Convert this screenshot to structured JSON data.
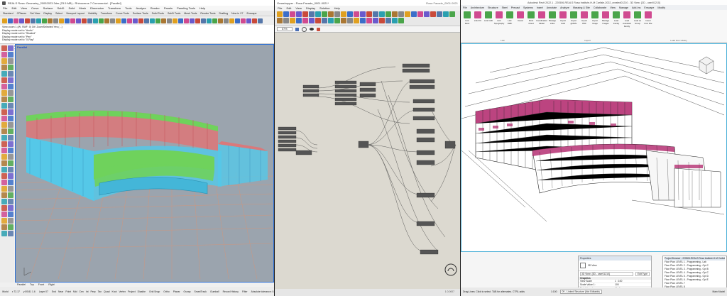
{
  "rhino": {
    "title": "REALS Rosa: Geometry_20052023.3dm (23.5 MB) - Rhinoceros 7 Commercial - [Parallel]",
    "menu": [
      "File",
      "Edit",
      "View",
      "Curve",
      "Surface",
      "SubD",
      "Solid",
      "Mesh",
      "Dimension",
      "Transform",
      "Tools",
      "Analyze",
      "Render",
      "Panels",
      "Paneling Tools",
      "Help"
    ],
    "tabs": [
      "Standard",
      "CPlanes",
      "Set View",
      "Display",
      "Select",
      "Viewport Layout",
      "Visibility",
      "Transform",
      "Curve Tools",
      "Surface Tools",
      "Solid Tools",
      "SubD Tools",
      "Mesh Tools",
      "Render Tools",
      "Drafting",
      "New in V7",
      "Enscape"
    ],
    "history": [
      "View zoom 1 (W, SWF: 0)   Dif: ZoomSelected  Yes  (...)",
      "Display mode set to \"Arctic\"",
      "Display mode set to \"Shaded\"",
      "Display mode set to \"Pen\"",
      "Display mode set to \"X-Ray\""
    ],
    "command_prompt": "Command:",
    "viewport_label": "Parallel",
    "viewport_tabs": [
      "Parallel",
      "Top",
      "Front",
      "Right"
    ],
    "status": [
      "World",
      "x 72.17",
      "y 89.81 1.6",
      "Layer 07",
      "Grid Snap",
      "Ortho",
      "Planar",
      "Osnap",
      "SmartTrack",
      "Gumball",
      "Record History",
      "Filter",
      "Absolute tolerance: 0.01"
    ],
    "osnaps": [
      "End",
      "Near",
      "Point",
      "Mid",
      "Cen",
      "Int",
      "Perp",
      "Tan",
      "Quad",
      "Knot",
      "Vertex",
      "Project",
      "Disable"
    ]
  },
  "grasshopper": {
    "title": "Grasshopper - Rosa Facade_0001.0021*",
    "filename": "Rosa Facade_0001.0021",
    "menu": [
      "File",
      "Edit",
      "View",
      "Display",
      "Solution",
      "Help"
    ],
    "zoom": "57%",
    "version": "1.0.0007"
  },
  "revit": {
    "title": "Autodesk Revit 2022.1 - 220506-REALS Rosa Institute-H-M Carlisle-2022_created01210 - 3D View: {3D - user01210}",
    "tabs": [
      "File",
      "Architecture",
      "Structure",
      "Steel",
      "Precast",
      "Systems",
      "Insert",
      "Annotate",
      "Analyze",
      "Massing & Site",
      "Collaborate",
      "View",
      "Manage",
      "Add-Ins",
      "Enscape",
      "Modify"
    ],
    "ribbon_buttons": [
      "Link Revit",
      "Link IFC",
      "Link CAD",
      "Link Topography",
      "Link DWF",
      "Decal",
      "Point Cloud",
      "Coordination Model",
      "Manage Links",
      "Import CAD",
      "Import gbXML",
      "Import PDF",
      "Import Image",
      "Manage Images",
      "Load Family",
      "Load Autodesk Family",
      "Load as Group",
      "Insert from File"
    ],
    "panel_labels": [
      "Link",
      "Import",
      "Load from Library"
    ],
    "properties": {
      "title": "Properties",
      "type": "3D View",
      "selector": "3D View: {3D - user01210}",
      "edit_type": "Edit Type",
      "group": "Graphics",
      "rows": [
        [
          "View Scale",
          "1 : 100"
        ],
        [
          "Scale Value 1:",
          "100"
        ],
        [
          "Detail Level",
          "Medium"
        ]
      ]
    },
    "browser": {
      "title": "Project Browser - 220506-REALS Rosa Institute-H-M Carlisle",
      "items": [
        "Floor Plan: LEVEL 1 - Programming - Lab",
        "Floor Plan: LEVEL 2 - Programming - Opt C",
        "Floor Plan: LEVEL 3 - Programming - Opt B",
        "Floor Plan: LEVEL 4 - Programming - Opt C",
        "Floor Plan: LEVEL 5 - Programming - Opt D",
        "Floor Plan: LEVEL 6 - Programming - Opt E",
        "Floor Plan: LEVEL 7",
        "Floor Plan: LEVEL 8",
        "Floor Plan: LEVEL 9"
      ]
    },
    "status": "Drag Lines: Click to select. TAB for alternates. CTRL adds",
    "workset": "09 - Linked Structure (Not Editable)",
    "scale": "1:100",
    "model": "Main Model"
  },
  "colors": {
    "rhino_viewport": "#9ba4ae",
    "facade_cyan": "#55c8e8",
    "facade_green": "#6fd25c",
    "facade_red": "#d9797b",
    "revit_magenta": "#b0236a",
    "gh_canvas": "#dcd9d0"
  }
}
